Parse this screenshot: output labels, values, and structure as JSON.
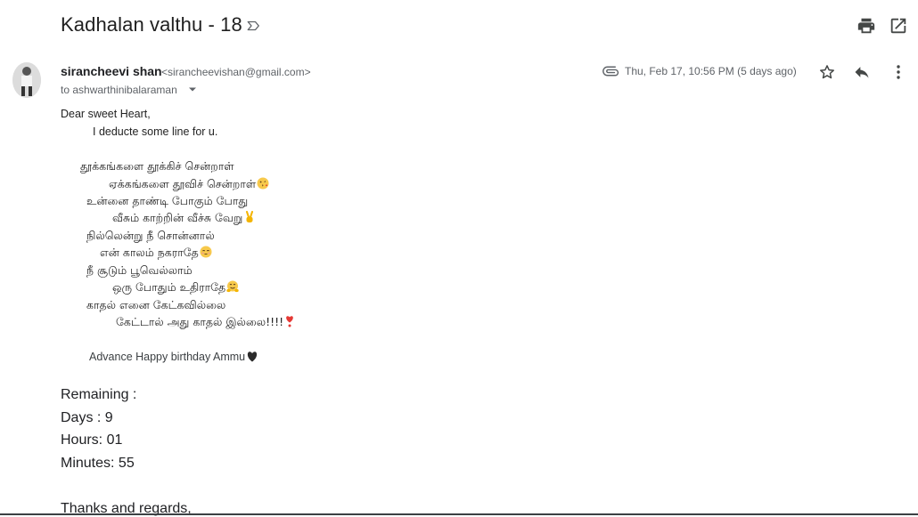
{
  "subject": "Kadhalan valthu - 18",
  "icons": {
    "label": "label-outline-icon",
    "print": "print-icon",
    "new_window": "open-in-new-window-icon",
    "attachment": "attachment-icon",
    "star": "star-icon",
    "reply": "reply-icon",
    "more": "more-vertical-icon",
    "caret": "chevron-down-icon"
  },
  "sender": {
    "name": "sirancheevi shan",
    "email": "<sirancheevishan@gmail.com>",
    "to": "to ashwarthinibalaraman",
    "date": "Thu, Feb 17, 10:56 PM (5 days ago)"
  },
  "body": {
    "greeting": "Dear sweet Heart,",
    "intro": "I deducte some line for u.",
    "poem": [
      "தூக்கங்களை தூக்கிச் சென்றாள்",
      "ஏக்கங்களை தூவிச் சென்றாள்",
      "உன்னை தாண்டி போகும் போது",
      "வீசும் காற்றின் வீச்சு வேறு",
      "நில்லென்று நீ சொன்னால்",
      "என் காலம் நகராதே",
      "நீ சூடும் பூவெல்லாம்",
      "ஒரு போதும் உதிராதே",
      "காதல் எனை கேட்கவில்லை",
      "கேட்டால் அது காதல் இல்லை!!!!"
    ],
    "birthday": "Advance Happy birthday Ammu",
    "remaining_label": "Remaining :",
    "days": "Days : 9",
    "hours": "Hours: 01",
    "minutes": "Minutes: 55",
    "closing": "Thanks and regards,"
  },
  "colors": {
    "text": "#202124",
    "muted": "#5f6368",
    "icon": "#444746"
  }
}
